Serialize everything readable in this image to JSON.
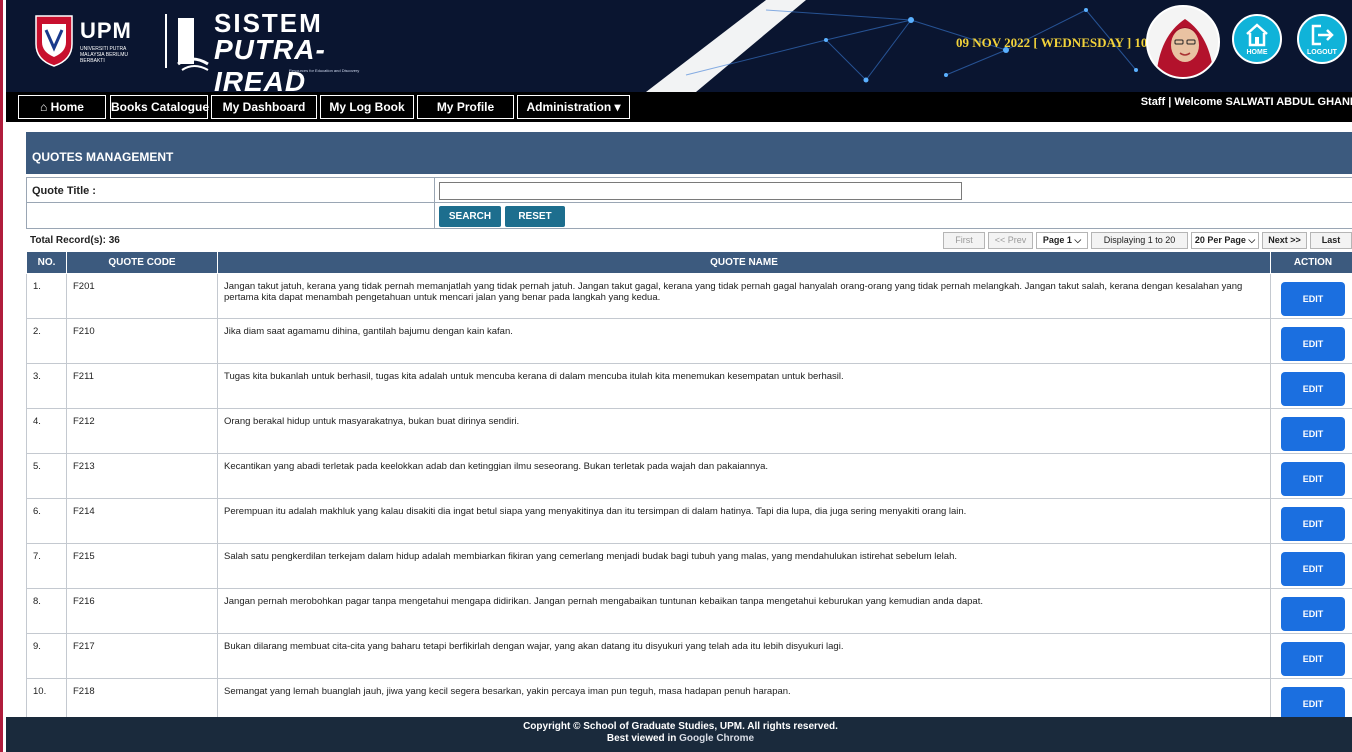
{
  "header": {
    "upm_text": "UPM",
    "upm_subtitle": "UNIVERSITI PUTRA MALAYSIA BERILMU BERBAKTI",
    "system_title": "SISTEM",
    "system_name": "PUTRA-IREAD",
    "system_tagline": "Resources for Education and Discovery",
    "datetime": "09 NOV 2022 [ WEDNESDAY ] 10:48 PM",
    "home_label": "HOME",
    "logout_label": "LOGOUT"
  },
  "nav": {
    "items": [
      {
        "label": "⌂ Home"
      },
      {
        "label": "Books Catalogue"
      },
      {
        "label": "My Dashboard"
      },
      {
        "label": "My Log Book"
      },
      {
        "label": "My Profile"
      },
      {
        "label": "Administration ▾"
      }
    ],
    "welcome": "Staff | Welcome SALWATI ABDUL GHANI"
  },
  "panel": {
    "title": "QUOTES MANAGEMENT",
    "filter_label": "Quote Title :",
    "filter_value": "",
    "search_label": "SEARCH",
    "reset_label": "RESET"
  },
  "pagination": {
    "total": "Total Record(s): 36",
    "first": "First",
    "prev": "<< Prev",
    "page": "Page 1",
    "displaying": "Displaying 1 to 20",
    "per_page": "20 Per Page",
    "next": "Next >>",
    "last": "Last"
  },
  "table": {
    "headers": [
      "NO.",
      "QUOTE CODE",
      "QUOTE NAME",
      "ACTION"
    ],
    "edit_label": "EDIT",
    "rows": [
      {
        "no": "1.",
        "code": "F201",
        "name": "Jangan takut jatuh, kerana yang tidak pernah memanjatlah yang tidak pernah jatuh. Jangan takut gagal, kerana yang tidak pernah gagal hanyalah orang-orang yang tidak pernah melangkah. Jangan takut salah, kerana dengan kesalahan yang pertama kita dapat menambah pengetahuan untuk mencari jalan yang benar pada langkah yang kedua."
      },
      {
        "no": "2.",
        "code": "F210",
        "name": "Jika diam saat agamamu dihina, gantilah bajumu dengan kain kafan."
      },
      {
        "no": "3.",
        "code": "F211",
        "name": "Tugas kita bukanlah untuk berhasil, tugas kita adalah untuk mencuba kerana di dalam mencuba itulah kita menemukan kesempatan untuk berhasil."
      },
      {
        "no": "4.",
        "code": "F212",
        "name": "Orang berakal hidup untuk masyarakatnya, bukan buat dirinya sendiri."
      },
      {
        "no": "5.",
        "code": "F213",
        "name": "Kecantikan yang abadi terletak pada keelokkan adab dan ketinggian ilmu seseorang. Bukan terletak pada wajah dan pakaiannya."
      },
      {
        "no": "6.",
        "code": "F214",
        "name": "Perempuan itu adalah makhluk yang kalau disakiti dia ingat betul siapa yang menyakitinya dan itu tersimpan di dalam hatinya. Tapi dia lupa, dia juga sering menyakiti orang lain."
      },
      {
        "no": "7.",
        "code": "F215",
        "name": "Salah satu pengkerdilan terkejam dalam hidup adalah membiarkan fikiran yang cemerlang menjadi budak bagi tubuh yang malas, yang mendahulukan istirehat sebelum lelah."
      },
      {
        "no": "8.",
        "code": "F216",
        "name": "Jangan pernah merobohkan pagar tanpa mengetahui mengapa didirikan. Jangan pernah mengabaikan tuntunan kebaikan tanpa mengetahui keburukan yang kemudian anda dapat."
      },
      {
        "no": "9.",
        "code": "F217",
        "name": "Bukan dilarang membuat cita-cita yang baharu tetapi berfikirlah dengan wajar, yang akan datang itu disyukuri yang telah ada itu lebih disyukuri lagi."
      },
      {
        "no": "10.",
        "code": "F218",
        "name": "Semangat yang lemah buanglah jauh, jiwa yang kecil segera besarkan, yakin percaya iman pun teguh, masa hadapan penuh harapan."
      }
    ]
  },
  "footer": {
    "copyright": "Copyright © School of Graduate Studies, UPM. All rights reserved.",
    "best_viewed": "Best viewed in",
    "browser": "Google Chrome"
  },
  "colors": {
    "header_bg": "#0a1530",
    "panel_header": "#3c5a7e",
    "edit_button": "#1b6fe0",
    "teal_button": "#1d6e8e",
    "date_text": "#f2d23a",
    "left_border": "#b01c3c"
  }
}
